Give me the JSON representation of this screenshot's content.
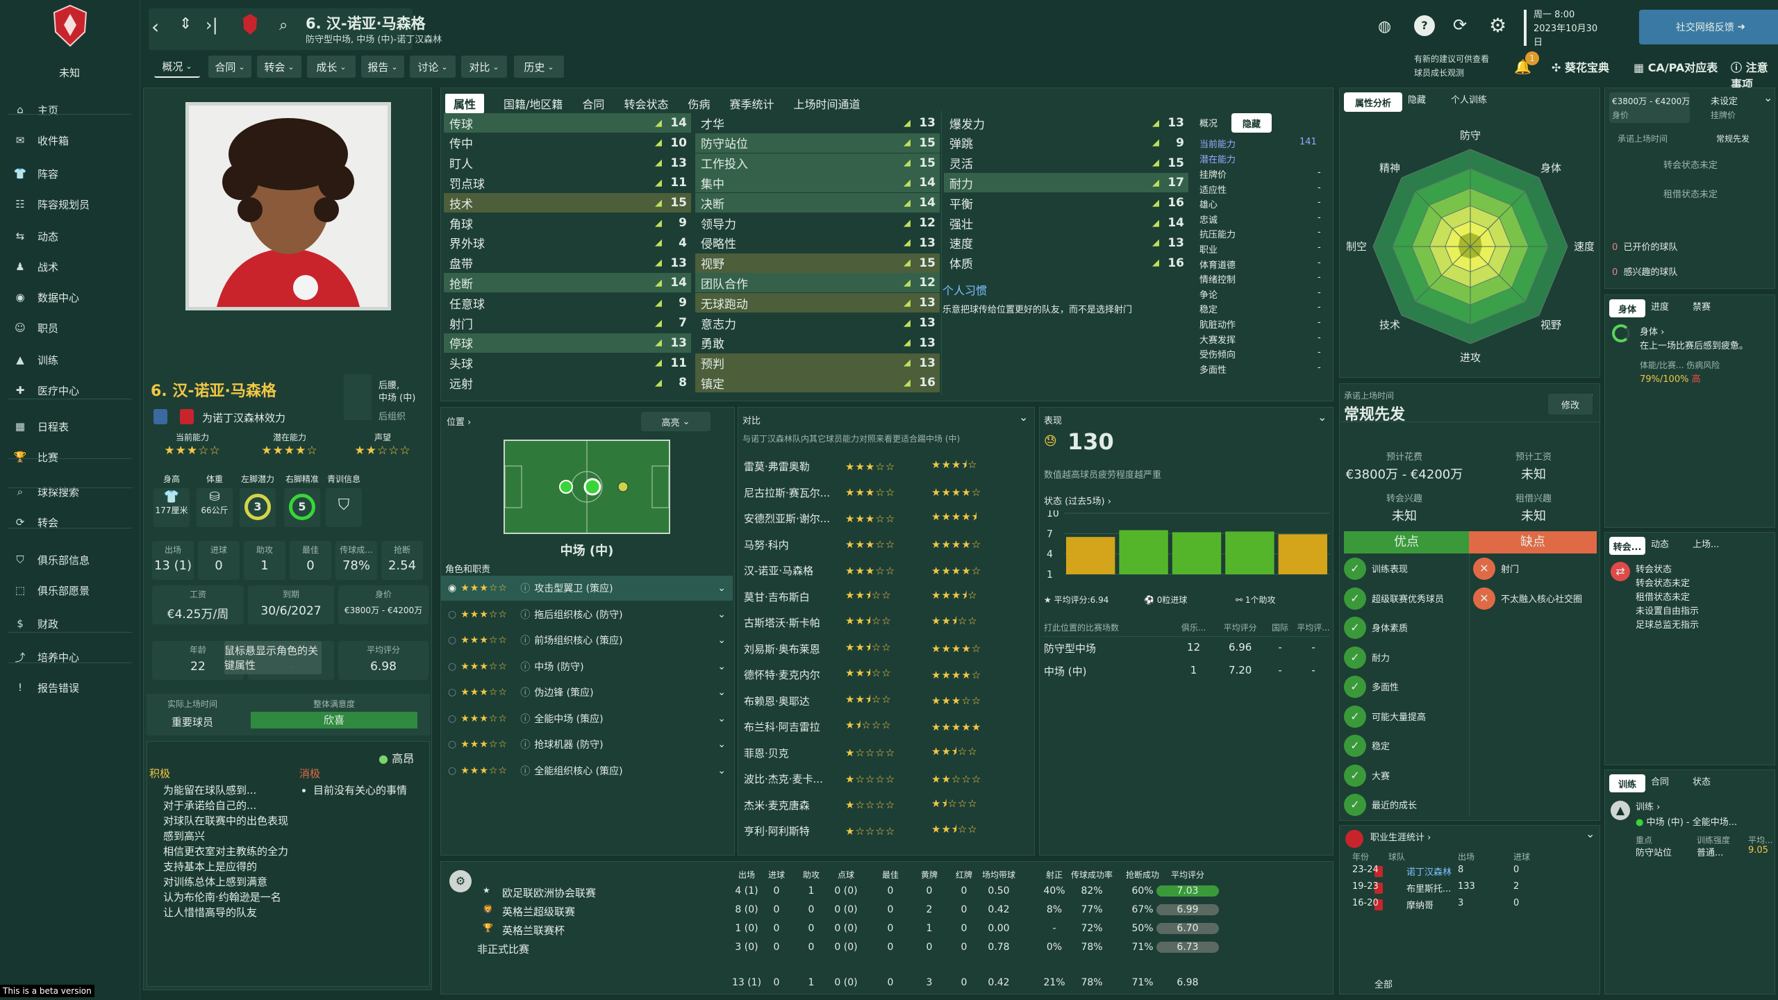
{
  "nav": {
    "club_name": "未知",
    "items": [
      "主页",
      "收件箱",
      "阵容",
      "阵容规划员",
      "动态",
      "战术",
      "数据中心",
      "职员",
      "训练",
      "医疗中心",
      "日程表",
      "比赛",
      "球探搜索",
      "转会",
      "俱乐部信息",
      "俱乐部愿景",
      "财政",
      "培养中心",
      "报告错误"
    ]
  },
  "header": {
    "player_title": "6. 汉-诺亚·马森格",
    "subtitle": "防守型中场, 中场 (中)-诺丁汉森林",
    "date_line1": "周一 8:00",
    "date_line2": "2023年10月30",
    "date_line3": "日",
    "social_button": "社交网络反馈",
    "menus": [
      "概况",
      "合同",
      "转会",
      "成长",
      "报告",
      "讨论",
      "对比",
      "历史"
    ],
    "notice_text1": "有新的建议可供查看",
    "notice_text2": "球员成长观测",
    "notice_count": "1",
    "links": [
      "葵花宝典",
      "CA/PA对应表",
      "注意事项"
    ]
  },
  "profile": {
    "name": "6. 汉-诺亚·马森格",
    "positions": "后腰,\n中场 (中)",
    "role": "后组织",
    "plays_for": "为诺丁汉森林效力",
    "ratings_labels": [
      "当前能力",
      "潜在能力",
      "声望"
    ],
    "ratings": [
      3,
      4,
      2
    ],
    "ratings_max": 5,
    "body_labels": [
      "身高",
      "体重",
      "左脚潜力",
      "右脚精准",
      "青训信息"
    ],
    "height": "177厘米",
    "weight": "66公斤",
    "left_foot": "3",
    "right_foot": "5",
    "stats_labels": [
      "出场",
      "进球",
      "助攻",
      "最佳",
      "传球成...",
      "抢断"
    ],
    "stats": [
      "13 (1)",
      "0",
      "1",
      "0",
      "78%",
      "2.54"
    ],
    "wage_label": "工资",
    "wage": "€4.25万/周",
    "contract_label": "到期",
    "contract": "30/6/2027",
    "value_label": "身价",
    "value": "€3800万 - €4200万",
    "age_label": "年龄",
    "age": "22",
    "injury_label": "伤病",
    "injury": "-",
    "avg_label": "平均评分",
    "avg": "6.98",
    "tooltip": "鼠标悬显示角色的关键属性",
    "playtime_label": "实际上场时间",
    "playtime": "重要球员",
    "satisfaction_label": "整体满意度",
    "satisfaction": "欣喜",
    "mood": "高昂",
    "positive_title": "积极",
    "negative_title": "消极",
    "positives": [
      "为能留在球队感到...",
      "对于承诺给自己的...",
      "对球队在联赛中的出色表现感到高兴",
      "相信更衣室对主教练的全力支持基本上是应得的",
      "对训练总体上感到满意",
      "认为布伦南·约翰逊是一名让人惜惜高导的队友"
    ],
    "negatives": [
      "目前没有关心的事情"
    ]
  },
  "attributes": {
    "tabs": [
      "属性",
      "国籍/地区籍",
      "合同",
      "转会状态",
      "伤病",
      "赛季统计",
      "上场时间通道"
    ],
    "technical": [
      [
        "传球",
        "14"
      ],
      [
        "传中",
        "10"
      ],
      [
        "盯人",
        "13"
      ],
      [
        "罚点球",
        "11"
      ],
      [
        "技术",
        "15"
      ],
      [
        "角球",
        "9"
      ],
      [
        "界外球",
        "4"
      ],
      [
        "盘带",
        "13"
      ],
      [
        "抢断",
        "14"
      ],
      [
        "任意球",
        "9"
      ],
      [
        "射门",
        "7"
      ],
      [
        "停球",
        "13"
      ],
      [
        "头球",
        "11"
      ],
      [
        "远射",
        "8"
      ]
    ],
    "mental": [
      [
        "才华",
        "13"
      ],
      [
        "防守站位",
        "15"
      ],
      [
        "工作投入",
        "15"
      ],
      [
        "集中",
        "14"
      ],
      [
        "决断",
        "14"
      ],
      [
        "领导力",
        "12"
      ],
      [
        "侵略性",
        "13"
      ],
      [
        "视野",
        "15"
      ],
      [
        "团队合作",
        "12"
      ],
      [
        "无球跑动",
        "13"
      ],
      [
        "意志力",
        "13"
      ],
      [
        "勇敢",
        "13"
      ],
      [
        "预判",
        "13"
      ],
      [
        "镇定",
        "16"
      ]
    ],
    "physical": [
      [
        "爆发力",
        "13"
      ],
      [
        "弹跳",
        "9"
      ],
      [
        "灵活",
        "15"
      ],
      [
        "耐力",
        "17"
      ],
      [
        "平衡",
        "16"
      ],
      [
        "强壮",
        "14"
      ],
      [
        "速度",
        "13"
      ],
      [
        "体质",
        "16"
      ]
    ],
    "habits_title": "个人习惯",
    "habits_text": "乐意把球传给位置更好的队友，而不是选择射门"
  },
  "side_panel": {
    "tabs": [
      "概况",
      "隐藏"
    ],
    "ca_label": "当前能力",
    "ca": "141",
    "pa_label": "潜在能力",
    "items": [
      "挂牌价",
      "适应性",
      "雄心",
      "忠诚",
      "抗压能力",
      "职业",
      "体育道德",
      "情绪控制",
      "争论",
      "稳定",
      "肮脏动作",
      "大赛发挥",
      "受伤倾向",
      "多面性"
    ],
    "dash": "-"
  },
  "position_panel": {
    "title": "位置",
    "mode": "高亮",
    "position_name": "中场 (中)",
    "roles_title": "角色和职责",
    "roles": [
      [
        "攻击型翼卫 (策应)",
        3
      ],
      [
        "拖后组织核心 (防守)",
        3
      ],
      [
        "前场组织核心 (策应)",
        3
      ],
      [
        "中场 (防守)",
        3
      ],
      [
        "伪边锋 (策应)",
        3
      ],
      [
        "全能中场 (策应)",
        3
      ],
      [
        "抢球机器 (防守)",
        3
      ],
      [
        "全能组织核心 (策应)",
        3
      ]
    ]
  },
  "compare": {
    "title": "对比",
    "desc": "与诺丁汉森林队内其它球员能力对照来看更适合踢中场 (中)",
    "rows": [
      [
        "雷莫·弗雷奥勒",
        3,
        3.5
      ],
      [
        "尼古拉斯·赛瓦尔...",
        3,
        4
      ],
      [
        "安德烈亚斯·谢尔...",
        3,
        4.5
      ],
      [
        "马努·科内",
        3,
        4
      ],
      [
        "汉-诺亚·马森格",
        3,
        4
      ],
      [
        "莫甘·吉布斯白",
        2.5,
        3.5
      ],
      [
        "古斯塔沃·斯卡帕",
        2.5,
        2.5
      ],
      [
        "刘易斯·奥布莱恩",
        2.5,
        4
      ],
      [
        "德怀特·麦克内尔",
        2.5,
        4
      ],
      [
        "布赖恩·奥耶达",
        2.5,
        3
      ],
      [
        "布兰科·阿吉雷拉",
        1.5,
        5
      ],
      [
        "菲恩·贝克",
        1,
        2.5
      ],
      [
        "波比·杰克·麦卡...",
        1,
        2
      ],
      [
        "杰米·麦克唐森",
        1,
        1.5
      ],
      [
        "亨利·阿利斯特",
        1,
        2.5
      ]
    ]
  },
  "form": {
    "title": "表现",
    "rating": "130",
    "desc": "数值越高球员疲劳程度越严重",
    "chart_title": "状态 (过去5场)",
    "avg_rating": "平均评分:6.94",
    "goals": "0粒进球",
    "assists": "1个助攻",
    "table_header": [
      "打此位置的比赛场数",
      "俱乐...",
      "平均评分",
      "国际",
      "平均评..."
    ],
    "table_rows": [
      [
        "防守型中场",
        "12",
        "6.96",
        "-",
        "-"
      ],
      [
        "中场 (中)",
        "1",
        "7.20",
        "-",
        "-"
      ]
    ]
  },
  "chart_data": {
    "type": "bar",
    "title": "状态 (过去5场)",
    "categories": [
      "1",
      "2",
      "3",
      "4",
      "5"
    ],
    "values": [
      6.5,
      7.5,
      7.2,
      7.3,
      6.9
    ],
    "ylim": [
      1,
      10
    ],
    "yticks": [
      "10",
      "7",
      "4",
      "1"
    ]
  },
  "analysis": {
    "tabs": [
      "属性分析",
      "隐藏",
      "个人训练"
    ],
    "axes": [
      "防守",
      "身体",
      "速度",
      "视野",
      "进攻",
      "技术",
      "制空",
      "精神"
    ],
    "axes_values": [
      0.72,
      0.72,
      0.6,
      0.66,
      0.62,
      0.68,
      0.62,
      0.72
    ]
  },
  "scout": {
    "title": "承诺上场时间",
    "value": "常规先发",
    "edit": "修改",
    "fee_label": "预计花费",
    "fee": "€3800万 - €4200万",
    "contract_label": "预计工资",
    "contract": "未知",
    "interest_label": "转会兴趣",
    "interest": "未知",
    "loan_label": "租借兴趣",
    "loan": "未知",
    "pros_title": "优点",
    "cons_title": "缺点",
    "pros": [
      "训练表现",
      "超级联赛优秀球员",
      "身体素质",
      "耐力",
      "多面性",
      "可能大量提高",
      "稳定",
      "大赛",
      "最近的成长"
    ],
    "cons": [
      "射门",
      "不太融入核心社交圈"
    ]
  },
  "career": {
    "title": "职业生涯统计",
    "headers": [
      "年份",
      "球队",
      "出场",
      "进球"
    ],
    "rows": [
      [
        "23-24",
        "诺丁汉森林",
        "8",
        "0"
      ],
      [
        "19-23",
        "布里斯托...",
        "133",
        "2"
      ],
      [
        "16-20",
        "摩纳哥",
        "3",
        "0"
      ]
    ],
    "total": "全部"
  },
  "season_table": {
    "headers": [
      "出场",
      "进球",
      "助攻",
      "点球",
      "最佳",
      "黄牌",
      "红牌",
      "场均带球",
      "射正",
      "传球成功率",
      "抢断成功",
      "平均评分"
    ],
    "rows": [
      [
        "欧足联欧洲协会联赛",
        "4 (1)",
        "0",
        "1",
        "0 (0)",
        "0",
        "0",
        "0",
        "0.50",
        "40%",
        "82%",
        "60%",
        "7.03"
      ],
      [
        "英格兰超级联赛",
        "8 (0)",
        "0",
        "0",
        "0 (0)",
        "0",
        "2",
        "0",
        "0.42",
        "8%",
        "77%",
        "67%",
        "6.99"
      ],
      [
        "英格兰联赛杯",
        "1 (0)",
        "0",
        "0",
        "0 (0)",
        "0",
        "1",
        "0",
        "0.00",
        "-",
        "72%",
        "50%",
        "6.70"
      ],
      [
        "非正式比赛",
        "3 (0)",
        "0",
        "0",
        "0 (0)",
        "0",
        "0",
        "0",
        "0.78",
        "0%",
        "78%",
        "71%",
        "6.73"
      ]
    ],
    "total": [
      "13 (1)",
      "0",
      "1",
      "0 (0)",
      "0",
      "3",
      "0",
      "0.42",
      "21%",
      "78%",
      "71%",
      "6.98"
    ]
  },
  "right_col": {
    "value_range": "€3800万 - €4200万",
    "value_label": "身价",
    "unset": "未设定",
    "unset_label": "挂牌价",
    "commit_label": "承诺上场时间",
    "commit": "常规先发",
    "transfer_status": "转会状态未定",
    "loan_status": "租借状态未定",
    "open_clubs": "已开价的球队",
    "open_clubs_count": "0",
    "interested": "感兴趣的球队",
    "interested_count": "0",
    "fitness_tabs": [
      "身体",
      "进度",
      "禁赛"
    ],
    "fitness_title": "身体",
    "fitness_desc": "在上一场比赛后感到疲惫。",
    "fitness_labels": "体能/比赛... 伤病风险",
    "fitness_value": "79%/100%",
    "fitness_risk": "高",
    "transfer_tabs": [
      "转会...",
      "动态",
      "上场..."
    ],
    "transfer_lines": [
      "转会状态",
      "转会状态未定",
      "租借状态未定",
      "未设置自由指示",
      "足球总监无指示"
    ],
    "training_tabs": [
      "训练",
      "合同",
      "状态"
    ],
    "training_title": "训练",
    "training_pos": "中场 (中) - 全能中场...",
    "focus_label": "重点",
    "focus": "防守站位",
    "intensity_label": "训练强度",
    "intensity": "普通...",
    "rating_label": "平均...",
    "rating": "9.05"
  },
  "beta": "This is a beta version",
  "colors": {
    "accent": "#7cd46a",
    "pros": "#3a9a3a",
    "cons": "#e06a46",
    "bar_gold": "#d4a41a",
    "bar_green": "#55b52a",
    "radar_outer": "#2b7d4a",
    "radar_mid": "#7ac34a",
    "radar_inner": "#e9f05a"
  }
}
